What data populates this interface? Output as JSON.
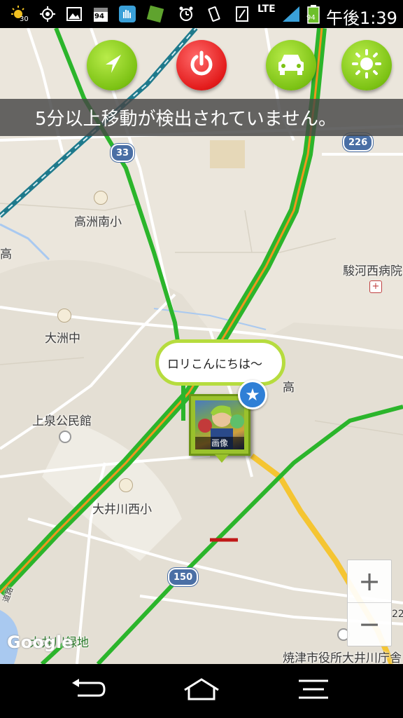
{
  "status_bar": {
    "weather_temp": "30",
    "calendar_day": "94",
    "battery_level": "94",
    "network": "LTE",
    "time": "午後1:39"
  },
  "toolbar": {
    "buttons": [
      {
        "name": "navigate",
        "icon": "compass-arrow-icon",
        "color": "#7cc214"
      },
      {
        "name": "power",
        "icon": "power-icon",
        "color": "#e31b1b"
      },
      {
        "name": "car",
        "icon": "car-icon",
        "color": "#7cc214"
      },
      {
        "name": "brightness",
        "icon": "sun-icon",
        "color": "#7cc214"
      }
    ]
  },
  "banner": {
    "message": "5分以上移動が検出されていません。"
  },
  "map": {
    "labels": {
      "school1": "高洲南小",
      "hospital": "駿河西病院",
      "school2": "大洲中",
      "hall": "上泉公民館",
      "school3": "大井川西小",
      "park": "大井川緑地",
      "office": "焼津市役所大井川庁舎",
      "partial_label": "高",
      "edge_left": "高",
      "edge_road": "道路",
      "edge_right": "22"
    },
    "route_shields": {
      "r33": "33",
      "r226": "226",
      "r150": "150"
    },
    "watermark": "Google",
    "colors": {
      "highway_green": "#2bb52b",
      "traffic_orange": "#f0961e",
      "main_road_yellow": "#f5c532",
      "rail_teal": "#1f7a8c"
    }
  },
  "marker": {
    "bubble_text": "ロリこんにちは〜",
    "avatar_caption": "画像",
    "badge_icon": "star-icon"
  },
  "zoom": {
    "plus": "+",
    "minus": "−"
  },
  "nav_bar": {
    "back": "back-icon",
    "home": "home-icon",
    "menu": "menu-icon"
  }
}
